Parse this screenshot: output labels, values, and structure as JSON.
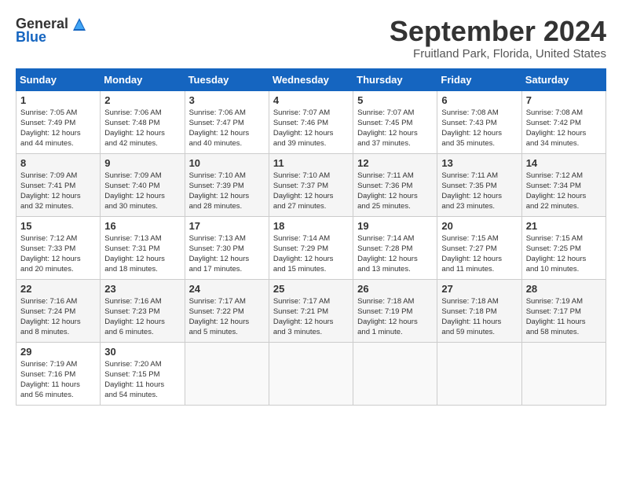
{
  "header": {
    "logo_general": "General",
    "logo_blue": "Blue",
    "month_title": "September 2024",
    "location": "Fruitland Park, Florida, United States"
  },
  "weekdays": [
    "Sunday",
    "Monday",
    "Tuesday",
    "Wednesday",
    "Thursday",
    "Friday",
    "Saturday"
  ],
  "weeks": [
    [
      {
        "day": "1",
        "text": "Sunrise: 7:05 AM\nSunset: 7:49 PM\nDaylight: 12 hours\nand 44 minutes."
      },
      {
        "day": "2",
        "text": "Sunrise: 7:06 AM\nSunset: 7:48 PM\nDaylight: 12 hours\nand 42 minutes."
      },
      {
        "day": "3",
        "text": "Sunrise: 7:06 AM\nSunset: 7:47 PM\nDaylight: 12 hours\nand 40 minutes."
      },
      {
        "day": "4",
        "text": "Sunrise: 7:07 AM\nSunset: 7:46 PM\nDaylight: 12 hours\nand 39 minutes."
      },
      {
        "day": "5",
        "text": "Sunrise: 7:07 AM\nSunset: 7:45 PM\nDaylight: 12 hours\nand 37 minutes."
      },
      {
        "day": "6",
        "text": "Sunrise: 7:08 AM\nSunset: 7:43 PM\nDaylight: 12 hours\nand 35 minutes."
      },
      {
        "day": "7",
        "text": "Sunrise: 7:08 AM\nSunset: 7:42 PM\nDaylight: 12 hours\nand 34 minutes."
      }
    ],
    [
      {
        "day": "8",
        "text": "Sunrise: 7:09 AM\nSunset: 7:41 PM\nDaylight: 12 hours\nand 32 minutes."
      },
      {
        "day": "9",
        "text": "Sunrise: 7:09 AM\nSunset: 7:40 PM\nDaylight: 12 hours\nand 30 minutes."
      },
      {
        "day": "10",
        "text": "Sunrise: 7:10 AM\nSunset: 7:39 PM\nDaylight: 12 hours\nand 28 minutes."
      },
      {
        "day": "11",
        "text": "Sunrise: 7:10 AM\nSunset: 7:37 PM\nDaylight: 12 hours\nand 27 minutes."
      },
      {
        "day": "12",
        "text": "Sunrise: 7:11 AM\nSunset: 7:36 PM\nDaylight: 12 hours\nand 25 minutes."
      },
      {
        "day": "13",
        "text": "Sunrise: 7:11 AM\nSunset: 7:35 PM\nDaylight: 12 hours\nand 23 minutes."
      },
      {
        "day": "14",
        "text": "Sunrise: 7:12 AM\nSunset: 7:34 PM\nDaylight: 12 hours\nand 22 minutes."
      }
    ],
    [
      {
        "day": "15",
        "text": "Sunrise: 7:12 AM\nSunset: 7:33 PM\nDaylight: 12 hours\nand 20 minutes."
      },
      {
        "day": "16",
        "text": "Sunrise: 7:13 AM\nSunset: 7:31 PM\nDaylight: 12 hours\nand 18 minutes."
      },
      {
        "day": "17",
        "text": "Sunrise: 7:13 AM\nSunset: 7:30 PM\nDaylight: 12 hours\nand 17 minutes."
      },
      {
        "day": "18",
        "text": "Sunrise: 7:14 AM\nSunset: 7:29 PM\nDaylight: 12 hours\nand 15 minutes."
      },
      {
        "day": "19",
        "text": "Sunrise: 7:14 AM\nSunset: 7:28 PM\nDaylight: 12 hours\nand 13 minutes."
      },
      {
        "day": "20",
        "text": "Sunrise: 7:15 AM\nSunset: 7:27 PM\nDaylight: 12 hours\nand 11 minutes."
      },
      {
        "day": "21",
        "text": "Sunrise: 7:15 AM\nSunset: 7:25 PM\nDaylight: 12 hours\nand 10 minutes."
      }
    ],
    [
      {
        "day": "22",
        "text": "Sunrise: 7:16 AM\nSunset: 7:24 PM\nDaylight: 12 hours\nand 8 minutes."
      },
      {
        "day": "23",
        "text": "Sunrise: 7:16 AM\nSunset: 7:23 PM\nDaylight: 12 hours\nand 6 minutes."
      },
      {
        "day": "24",
        "text": "Sunrise: 7:17 AM\nSunset: 7:22 PM\nDaylight: 12 hours\nand 5 minutes."
      },
      {
        "day": "25",
        "text": "Sunrise: 7:17 AM\nSunset: 7:21 PM\nDaylight: 12 hours\nand 3 minutes."
      },
      {
        "day": "26",
        "text": "Sunrise: 7:18 AM\nSunset: 7:19 PM\nDaylight: 12 hours\nand 1 minute."
      },
      {
        "day": "27",
        "text": "Sunrise: 7:18 AM\nSunset: 7:18 PM\nDaylight: 11 hours\nand 59 minutes."
      },
      {
        "day": "28",
        "text": "Sunrise: 7:19 AM\nSunset: 7:17 PM\nDaylight: 11 hours\nand 58 minutes."
      }
    ],
    [
      {
        "day": "29",
        "text": "Sunrise: 7:19 AM\nSunset: 7:16 PM\nDaylight: 11 hours\nand 56 minutes."
      },
      {
        "day": "30",
        "text": "Sunrise: 7:20 AM\nSunset: 7:15 PM\nDaylight: 11 hours\nand 54 minutes."
      },
      {
        "day": "",
        "text": ""
      },
      {
        "day": "",
        "text": ""
      },
      {
        "day": "",
        "text": ""
      },
      {
        "day": "",
        "text": ""
      },
      {
        "day": "",
        "text": ""
      }
    ]
  ]
}
